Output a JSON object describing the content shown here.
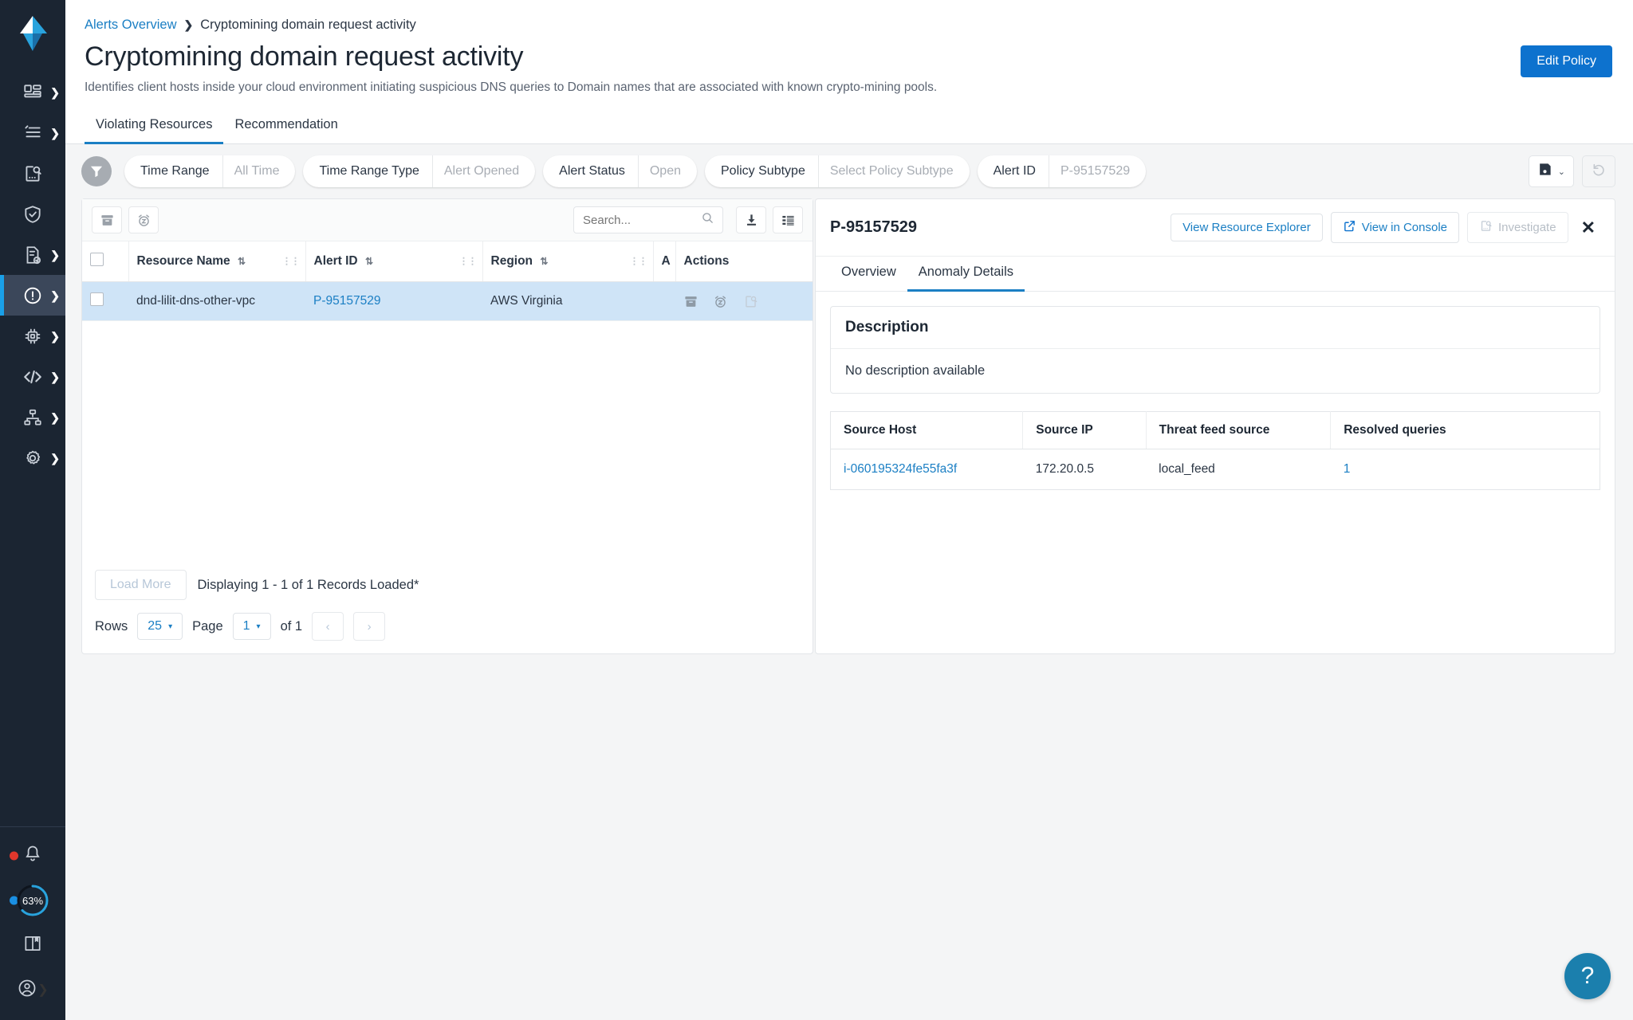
{
  "sidebar": {
    "logo": "prisma-cloud-logo",
    "items": [
      {
        "name": "dashboard",
        "icon": "dashboard-icon",
        "chevron": true,
        "active": false
      },
      {
        "name": "inventory",
        "icon": "list-inventory-icon",
        "chevron": true,
        "active": false
      },
      {
        "name": "investigate",
        "icon": "investigate-search-icon",
        "chevron": false,
        "active": false
      },
      {
        "name": "policies",
        "icon": "shield-check-icon",
        "chevron": false,
        "active": false
      },
      {
        "name": "compliance",
        "icon": "report-check-icon",
        "chevron": true,
        "active": false
      },
      {
        "name": "alerts",
        "icon": "alert-exclamation-icon",
        "chevron": true,
        "active": true
      },
      {
        "name": "compute",
        "icon": "chip-icon",
        "chevron": true,
        "active": false
      },
      {
        "name": "code-security",
        "icon": "code-brackets-icon",
        "chevron": true,
        "active": false
      },
      {
        "name": "network",
        "icon": "network-topology-icon",
        "chevron": true,
        "active": false
      },
      {
        "name": "settings",
        "icon": "gear-icon",
        "chevron": true,
        "active": false
      }
    ],
    "bottom": {
      "notifications_icon": "bell-icon",
      "progress_label": "63%",
      "progress_value": 63,
      "docs_icon": "book-icon",
      "profile_icon": "user-circle-icon",
      "expand_label": "❯"
    }
  },
  "header": {
    "breadcrumb_link": "Alerts Overview",
    "breadcrumb_separator": "❯",
    "breadcrumb_current": "Cryptomining domain request activity",
    "title": "Cryptomining domain request activity",
    "subtitle": "Identifies client hosts inside your cloud environment initiating suspicious DNS queries to Domain names that are associated with known crypto-mining pools.",
    "edit_policy_label": "Edit Policy"
  },
  "tabs": [
    {
      "label": "Violating Resources",
      "active": true
    },
    {
      "label": "Recommendation",
      "active": false
    }
  ],
  "filters": {
    "funnel_icon": "funnel-icon",
    "chips": [
      {
        "key": "Time Range",
        "value": "All Time"
      },
      {
        "key": "Time Range Type",
        "value": "Alert Opened"
      },
      {
        "key": "Alert Status",
        "value": "Open"
      },
      {
        "key": "Policy Subtype",
        "value": "Select Policy Subtype"
      },
      {
        "key": "Alert ID",
        "value": "P-95157529"
      }
    ],
    "save_icon": "floppy-save-icon",
    "save_caret": "⌄",
    "reset_icon": "reset-undo-icon"
  },
  "table": {
    "toolbar": [
      {
        "name": "archive-button",
        "icon": "archive-box-icon"
      },
      {
        "name": "snooze-button",
        "icon": "snooze-alarm-icon"
      }
    ],
    "search_placeholder": "Search...",
    "search_value": "",
    "search_icon": "search-icon",
    "download_icon": "download-icon",
    "columns_icon": "column-settings-icon",
    "columns": [
      {
        "label": "",
        "type": "checkbox"
      },
      {
        "label": "Resource Name",
        "sortable": true
      },
      {
        "label": "Alert ID",
        "sortable": true
      },
      {
        "label": "Region",
        "sortable": true
      },
      {
        "label": "A",
        "sortable": false
      },
      {
        "label": "Actions",
        "sortable": false
      }
    ],
    "rows": [
      {
        "selected": true,
        "resource_name": "dnd-lilit-dns-other-vpc",
        "alert_id": "P-95157529",
        "region": "AWS Virginia",
        "actions": [
          "archive-box-icon",
          "snooze-alarm-icon",
          "investigate-icon"
        ]
      }
    ],
    "footer": {
      "load_more_label": "Load More",
      "records_text": "Displaying 1 - 1 of 1 Records Loaded*",
      "rows_label": "Rows",
      "rows_value": "25",
      "page_label": "Page",
      "page_value": "1",
      "of_label": "of 1",
      "prev_label": "‹",
      "next_label": "›"
    }
  },
  "detail": {
    "id": "P-95157529",
    "buttons": [
      {
        "label": "View Resource Explorer",
        "icon": "",
        "disabled": false
      },
      {
        "label": "View in Console",
        "icon": "external-link-icon",
        "disabled": false
      },
      {
        "label": "Investigate",
        "icon": "investigate-search-icon",
        "disabled": true
      }
    ],
    "close_label": "✕",
    "tabs": [
      {
        "label": "Overview",
        "active": false
      },
      {
        "label": "Anomaly Details",
        "active": true
      }
    ],
    "description": {
      "heading": "Description",
      "body": "No description available"
    },
    "anomaly_table": {
      "columns": [
        "Source Host",
        "Source IP",
        "Threat feed source",
        "Resolved queries"
      ],
      "rows": [
        {
          "source_host": "i-060195324fe55fa3f",
          "source_ip": "172.20.0.5",
          "threat_feed_source": "local_feed",
          "resolved_queries": "1"
        }
      ]
    }
  },
  "help": {
    "label": "?"
  },
  "colors": {
    "accent_blue": "#1b7fc4",
    "primary_button": "#0d72ce",
    "sidebar_bg": "#1b2532",
    "sidebar_active": "#3b475a",
    "active_marker": "#1aa0e8",
    "row_selected": "#cfe4f7",
    "help_fab": "#1b7fad",
    "notification_dot": "#e0372c",
    "page_bg": "#f4f5f6"
  }
}
